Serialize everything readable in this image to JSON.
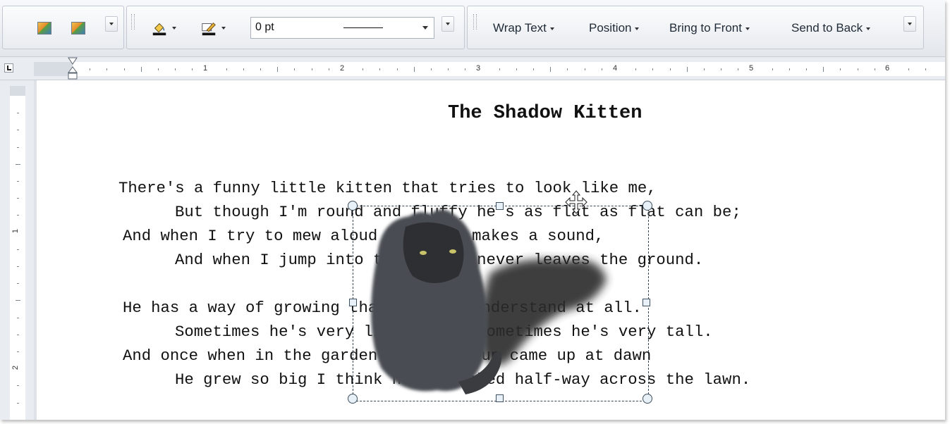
{
  "toolbar": {
    "wrap_text": "Wrap Text",
    "position": "Position",
    "bring_to_front": "Bring to Front",
    "send_to_back": "Send to Back",
    "line_weight_value": "0 pt"
  },
  "ruler": {
    "numbers": [
      "1",
      "2",
      "3",
      "4",
      "5",
      "6"
    ],
    "vertical_numbers": [
      "1",
      "2"
    ]
  },
  "document": {
    "title": "The Shadow Kitten",
    "lines": [
      "There's a funny little kitten that tries to look like me,",
      "But though I'm round and fluffy he's as flat as flat can be;",
      "And when I try to mew aloud he never makes a sound,",
      "And when I jump into the air he never leaves the ground.",
      "He has a way of growing that I don't understand at all.",
      "Sometimes he's very little, and sometimes he's very tall.",
      "And once when in the garden when the sun came up at dawn",
      "He grew so big I think he stretched half-way across the lawn."
    ]
  },
  "colors": {
    "accent_icon_fill": "#f1c24a",
    "selection_border": "#3a4653"
  },
  "icons": {
    "picture_1": "insert-picture-icon",
    "picture_2": "change-picture-icon",
    "fill": "fill-color-icon",
    "outline": "outline-color-icon"
  }
}
